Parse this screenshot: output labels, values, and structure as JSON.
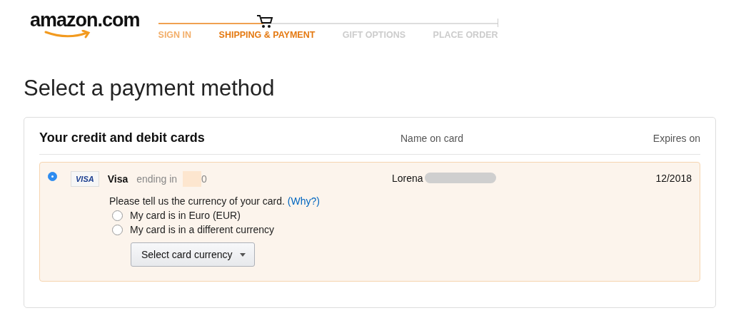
{
  "logo": {
    "text": "amazon.com"
  },
  "checkout_progress": {
    "level": 0.31,
    "steps": [
      {
        "label": "SIGN IN",
        "done": true,
        "selected": false
      },
      {
        "label": "SHIPPING & PAYMENT",
        "done": false,
        "selected": true
      },
      {
        "label": "GIFT OPTIONS",
        "done": false,
        "selected": false
      },
      {
        "label": "PLACE ORDER",
        "done": false,
        "selected": false
      }
    ]
  },
  "page_title": "Select a payment method",
  "cards_panel": {
    "title": "Your credit and debit cards",
    "columns": [
      "Name on card",
      "Expires on"
    ],
    "cards": [
      {
        "selected": true,
        "brand_badge": "VISA",
        "brand": "Visa",
        "ending_label": "ending in",
        "last_digit": "0",
        "name": "Lorena",
        "expires": "12/2018",
        "currency_prompt": "Please tell us the currency of your card.",
        "why_link": "(Why?)",
        "currency_options": [
          {
            "label": "My card is in Euro (EUR)",
            "selected": false
          },
          {
            "label": "My card is in a different currency",
            "selected": false
          }
        ],
        "currency_dropdown": "Select card currency"
      }
    ]
  }
}
